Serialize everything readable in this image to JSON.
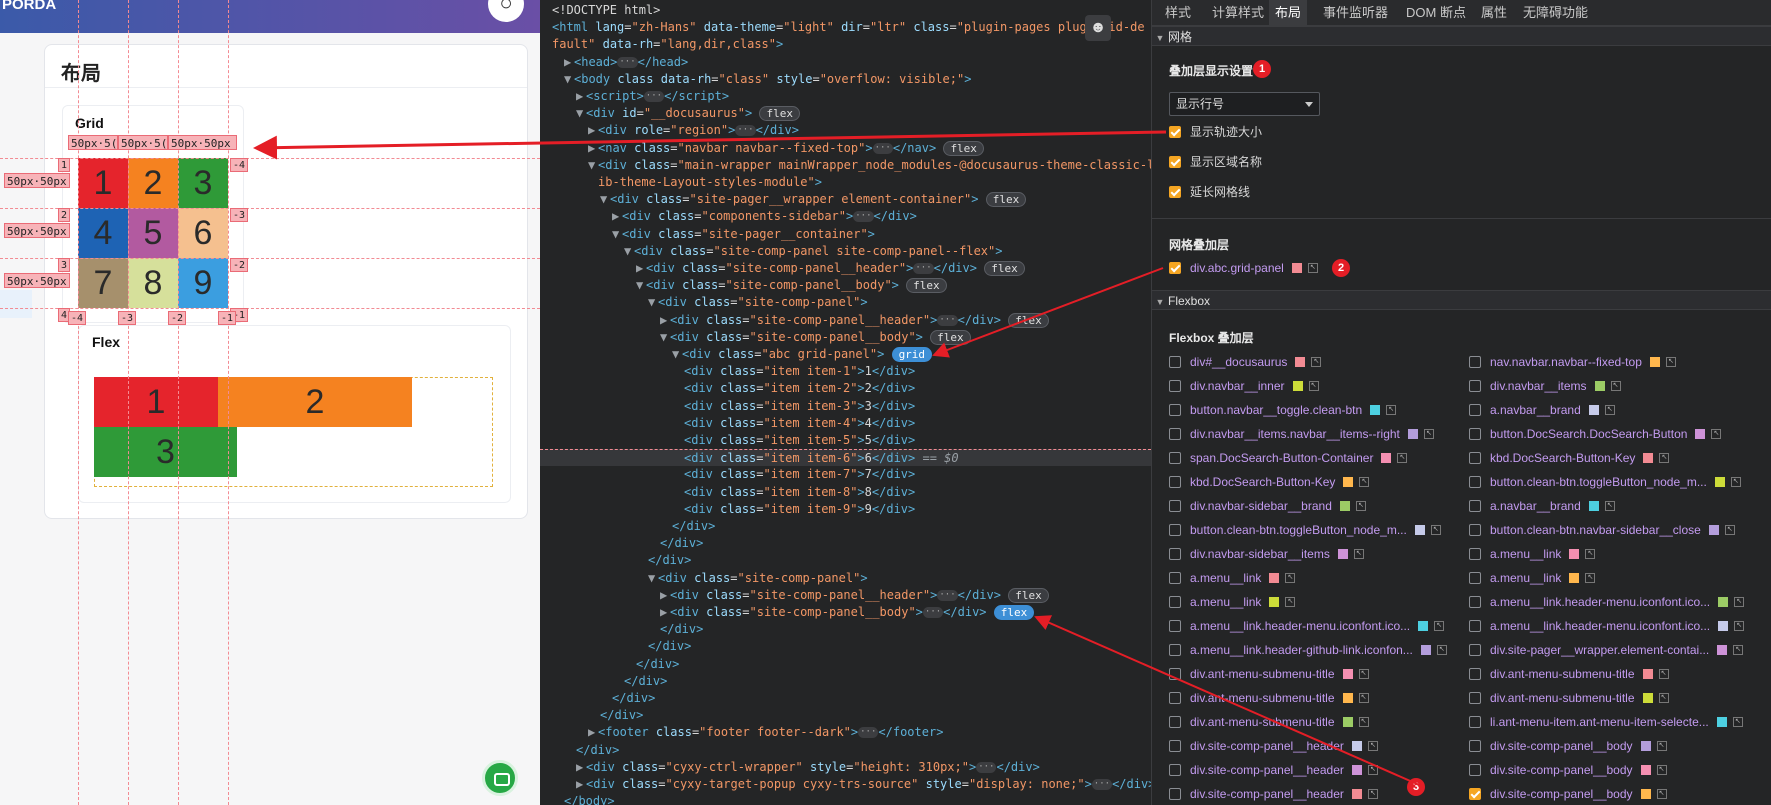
{
  "left_page": {
    "brand": "PORDA",
    "card_title": "布局",
    "grid_title": "Grid",
    "flex_title": "Flex",
    "col_size_labels": [
      "50px·5(",
      "50px·5(",
      "50px·50px"
    ],
    "row_size_labels": [
      "50px·50px",
      "50px·50px",
      "50px·50px"
    ],
    "row_line_left": [
      "1",
      "2",
      "3",
      "4"
    ],
    "row_line_right": [
      "-4",
      "-3",
      "-2",
      "-1"
    ],
    "col_line_bottom": [
      "-4",
      "-3",
      "-2",
      "-1"
    ],
    "grid_items": [
      {
        "label": "1",
        "color": "#e5242c"
      },
      {
        "label": "2",
        "color": "#f58220"
      },
      {
        "label": "3",
        "color": "#2f9a38"
      },
      {
        "label": "4",
        "color": "#1e63b4"
      },
      {
        "label": "5",
        "color": "#b25aa0"
      },
      {
        "label": "6",
        "color": "#f5c08f"
      },
      {
        "label": "7",
        "color": "#a6906c"
      },
      {
        "label": "8",
        "color": "#d6e09b"
      },
      {
        "label": "9",
        "color": "#3b9ee0"
      }
    ],
    "flex_items": [
      {
        "label": "1",
        "color": "#e5242c"
      },
      {
        "label": "2",
        "color": "#f58220"
      },
      {
        "label": "3",
        "color": "#2f9a38"
      }
    ]
  },
  "elements_panel": {
    "lines": [
      {
        "i": 0,
        "html": "&lt;!DOCTYPE html&gt;"
      },
      {
        "i": 0,
        "html": "<span class='t'>&lt;html</span> <span class='a'>lang</span>=<span class='v'>\"zh-Hans\"</span> <span class='a'>data-theme</span>=<span class='v'>\"light\"</span> <span class='a'>dir</span>=<span class='v'>\"ltr\"</span> <span class='a'>class</span>=<span class='v'>\"plugin-pages plugin-id-de</span>"
      },
      {
        "i": 0,
        "html": "<span class='v'>fault\"</span> <span class='a'>data-rh</span>=<span class='v'>\"lang,dir,class\"</span><span class='t'>&gt;</span>"
      },
      {
        "i": 1,
        "html": "<span class='ar'>▶</span><span class='t'>&lt;head&gt;</span><span class='dots'>···</span><span class='t'>&lt;/head&gt;</span>"
      },
      {
        "i": 1,
        "html": "<span class='ar'>▼</span><span class='t'>&lt;body</span> <span class='a'>class</span> <span class='a'>data-rh</span>=<span class='v'>\"class\"</span> <span class='a'>style</span>=<span class='v'>\"overflow: visible;\"</span><span class='t'>&gt;</span>"
      },
      {
        "i": 2,
        "html": "<span class='ar'>▶</span><span class='t'>&lt;script&gt;</span><span class='dots'>···</span><span class='t'>&lt;/script&gt;</span>"
      },
      {
        "i": 2,
        "html": "<span class='ar'>▼</span><span class='t'>&lt;div</span> <span class='a'>id</span>=<span class='v'>\"__docusaurus\"</span><span class='t'>&gt;</span> <span class='badge'>flex</span>"
      },
      {
        "i": 3,
        "html": "<span class='ar'>▶</span><span class='t'>&lt;div</span> <span class='a'>role</span>=<span class='v'>\"region\"</span><span class='t'>&gt;</span><span class='dots'>···</span><span class='t'>&lt;/div&gt;</span>"
      },
      {
        "i": 3,
        "html": "<span class='ar'>▶</span><span class='t'>&lt;nav</span> <span class='a'>class</span>=<span class='v'>\"navbar navbar--fixed-top\"</span><span class='t'>&gt;</span><span class='dots'>···</span><span class='t'>&lt;/nav&gt;</span> <span class='badge'>flex</span>"
      },
      {
        "i": 3,
        "html": "<span class='ar'>▼</span><span class='t'>&lt;div</span> <span class='a'>class</span>=<span class='v'>\"main-wrapper mainWrapper_node_modules-@docusaurus-theme-classic-l</span>"
      },
      {
        "i": 3,
        "html": "<span class='ar'> </span><span class='v'>ib-theme-Layout-styles-module\"</span><span class='t'>&gt;</span>"
      },
      {
        "i": 4,
        "html": "<span class='ar'>▼</span><span class='t'>&lt;div</span> <span class='a'>class</span>=<span class='v'>\"site-pager__wrapper element-container\"</span><span class='t'>&gt;</span> <span class='badge'>flex</span>"
      },
      {
        "i": 5,
        "html": "<span class='ar'>▶</span><span class='t'>&lt;div</span> <span class='a'>class</span>=<span class='v'>\"components-sidebar\"</span><span class='t'>&gt;</span><span class='dots'>···</span><span class='t'>&lt;/div&gt;</span>"
      },
      {
        "i": 5,
        "html": "<span class='ar'>▼</span><span class='t'>&lt;div</span> <span class='a'>class</span>=<span class='v'>\"site-pager__container\"</span><span class='t'>&gt;</span>"
      },
      {
        "i": 6,
        "html": "<span class='ar'>▼</span><span class='t'>&lt;div</span> <span class='a'>class</span>=<span class='v'>\"site-comp-panel site-comp-panel--flex\"</span><span class='t'>&gt;</span>"
      },
      {
        "i": 7,
        "html": "<span class='ar'>▶</span><span class='t'>&lt;div</span> <span class='a'>class</span>=<span class='v'>\"site-comp-panel__header\"</span><span class='t'>&gt;</span><span class='dots'>···</span><span class='t'>&lt;/div&gt;</span> <span class='badge'>flex</span>"
      },
      {
        "i": 7,
        "html": "<span class='ar'>▼</span><span class='t'>&lt;div</span> <span class='a'>class</span>=<span class='v'>\"site-comp-panel__body\"</span><span class='t'>&gt;</span> <span class='badge'>flex</span>"
      },
      {
        "i": 8,
        "html": "<span class='ar'>▼</span><span class='t'>&lt;div</span> <span class='a'>class</span>=<span class='v'>\"site-comp-panel\"</span><span class='t'>&gt;</span>"
      },
      {
        "i": 9,
        "html": "<span class='ar'>▶</span><span class='t'>&lt;div</span> <span class='a'>class</span>=<span class='v'>\"site-comp-panel__header\"</span><span class='t'>&gt;</span><span class='dots'>···</span><span class='t'>&lt;/div&gt;</span> <span class='badge'>flex</span>"
      },
      {
        "i": 9,
        "html": "<span class='ar'>▼</span><span class='t'>&lt;div</span> <span class='a'>class</span>=<span class='v'>\"site-comp-panel__body\"</span><span class='t'>&gt;</span> <span class='badge'>flex</span>"
      },
      {
        "i": 10,
        "html": "<span class='ar'>▼</span><span class='t'>&lt;div</span> <span class='a'>class</span>=<span class='v'>\"abc grid-panel\"</span><span class='t'>&gt;</span> <span class='badge sel'>grid</span>"
      },
      {
        "i": 11,
        "html": "<span class='t'>&lt;div</span> <span class='a'>class</span>=<span class='v'>\"item item-1\"</span><span class='t'>&gt;</span><span class='p'>1</span><span class='t'>&lt;/div&gt;</span>"
      },
      {
        "i": 11,
        "html": "<span class='t'>&lt;div</span> <span class='a'>class</span>=<span class='v'>\"item item-2\"</span><span class='t'>&gt;</span><span class='p'>2</span><span class='t'>&lt;/div&gt;</span>"
      },
      {
        "i": 11,
        "html": "<span class='t'>&lt;div</span> <span class='a'>class</span>=<span class='v'>\"item item-3\"</span><span class='t'>&gt;</span><span class='p'>3</span><span class='t'>&lt;/div&gt;</span>"
      },
      {
        "i": 11,
        "html": "<span class='t'>&lt;div</span> <span class='a'>class</span>=<span class='v'>\"item item-4\"</span><span class='t'>&gt;</span><span class='p'>4</span><span class='t'>&lt;/div&gt;</span>"
      },
      {
        "i": 11,
        "html": "<span class='t'>&lt;div</span> <span class='a'>class</span>=<span class='v'>\"item item-5\"</span><span class='t'>&gt;</span><span class='p'>5</span><span class='t'>&lt;/div&gt;</span>"
      },
      {
        "i": 11,
        "hl": true,
        "html": "<span class='t'>&lt;div</span> <span class='a'>class</span>=<span class='v'>\"item item-6\"</span><span class='t'>&gt;</span><span class='p'>6</span><span class='t'>&lt;/div&gt;</span> <span class='dim'>== $0</span>"
      },
      {
        "i": 11,
        "html": "<span class='t'>&lt;div</span> <span class='a'>class</span>=<span class='v'>\"item item-7\"</span><span class='t'>&gt;</span><span class='p'>7</span><span class='t'>&lt;/div&gt;</span>"
      },
      {
        "i": 11,
        "html": "<span class='t'>&lt;div</span> <span class='a'>class</span>=<span class='v'>\"item item-8\"</span><span class='t'>&gt;</span><span class='p'>8</span><span class='t'>&lt;/div&gt;</span>"
      },
      {
        "i": 11,
        "html": "<span class='t'>&lt;div</span> <span class='a'>class</span>=<span class='v'>\"item item-9\"</span><span class='t'>&gt;</span><span class='p'>9</span><span class='t'>&lt;/div&gt;</span>"
      },
      {
        "i": 10,
        "html": "<span class='t'>&lt;/div&gt;</span>"
      },
      {
        "i": 9,
        "html": "<span class='t'>&lt;/div&gt;</span>"
      },
      {
        "i": 8,
        "html": "<span class='t'>&lt;/div&gt;</span>"
      },
      {
        "i": 8,
        "html": "<span class='ar'>▼</span><span class='t'>&lt;div</span> <span class='a'>class</span>=<span class='v'>\"site-comp-panel\"</span><span class='t'>&gt;</span>"
      },
      {
        "i": 9,
        "html": "<span class='ar'>▶</span><span class='t'>&lt;div</span> <span class='a'>class</span>=<span class='v'>\"site-comp-panel__header\"</span><span class='t'>&gt;</span><span class='dots'>···</span><span class='t'>&lt;/div&gt;</span> <span class='badge'>flex</span>"
      },
      {
        "i": 9,
        "html": "<span class='ar'>▶</span><span class='t'>&lt;div</span> <span class='a'>class</span>=<span class='v'>\"site-comp-panel__body\"</span><span class='t'>&gt;</span><span class='dots'>···</span><span class='t'>&lt;/div&gt;</span> <span class='badge sel'>flex</span>"
      },
      {
        "i": 9,
        "html": "<span class='t'>&lt;/div&gt;</span>"
      },
      {
        "i": 8,
        "html": "<span class='t'>&lt;/div&gt;</span>"
      },
      {
        "i": 7,
        "html": "<span class='t'>&lt;/div&gt;</span>"
      },
      {
        "i": 6,
        "html": "<span class='t'>&lt;/div&gt;</span>"
      },
      {
        "i": 5,
        "html": "<span class='t'>&lt;/div&gt;</span>"
      },
      {
        "i": 4,
        "html": "<span class='t'>&lt;/div&gt;</span>"
      },
      {
        "i": 3,
        "html": "<span class='ar'>▶</span><span class='t'>&lt;footer</span> <span class='a'>class</span>=<span class='v'>\"footer footer--dark\"</span><span class='t'>&gt;</span><span class='dots'>···</span><span class='t'>&lt;/footer&gt;</span>"
      },
      {
        "i": 2,
        "html": "<span class='t'>&lt;/div&gt;</span>"
      },
      {
        "i": 2,
        "html": "<span class='ar'>▶</span><span class='t'>&lt;div</span> <span class='a'>class</span>=<span class='v'>\"cyxy-ctrl-wrapper\"</span> <span class='a'>style</span>=<span class='v'>\"height: 310px;\"</span><span class='t'>&gt;</span><span class='dots'>···</span><span class='t'>&lt;/div&gt;</span>"
      },
      {
        "i": 2,
        "html": "<span class='ar'>▶</span><span class='t'>&lt;div</span> <span class='a'>class</span>=<span class='v'>\"cyxy-target-popup cyxy-trs-source\"</span> <span class='a'>style</span>=<span class='v'>\"display: none;\"</span><span class='t'>&gt;</span><span class='dots'>···</span><span class='t'>&lt;/div&gt;</span>"
      },
      {
        "i": 1,
        "html": "<span class='t'>&lt;/body&gt;</span>"
      }
    ],
    "gutter_marker": "···"
  },
  "right_panel": {
    "tabs": [
      "样式",
      "计算样式",
      "布局",
      "事件监听器",
      "DOM 断点",
      "属性",
      "无障碍功能"
    ],
    "active_tab": 2,
    "grid_section": "网格",
    "overlay_settings_title": "叠加层显示设置",
    "line_select_value": "显示行号",
    "options": [
      {
        "label": "显示轨迹大小",
        "checked": true
      },
      {
        "label": "显示区域名称",
        "checked": true
      },
      {
        "label": "延长网格线",
        "checked": true
      }
    ],
    "grid_overlays_title": "网格叠加层",
    "grid_overlay_item": {
      "label": "div.abc.grid-panel",
      "color": "#f28b93",
      "checked": true
    },
    "flexbox_section": "Flexbox",
    "flexbox_overlays_title": "Flexbox 叠加层",
    "flex_left": [
      {
        "label": "div#__docusaurus",
        "color": "#f28b93",
        "checked": false
      },
      {
        "label": "div.navbar__inner",
        "color": "#cddc39",
        "checked": false
      },
      {
        "label": "button.navbar__toggle.clean-btn",
        "color": "#4dd0e1",
        "checked": false
      },
      {
        "label": "div.navbar__items.navbar__items--right",
        "color": "#b39ddb",
        "checked": false
      },
      {
        "label": "span.DocSearch-Button-Container",
        "color": "#f48fb1",
        "checked": false
      },
      {
        "label": "kbd.DocSearch-Button-Key",
        "color": "#ffb74d",
        "checked": false
      },
      {
        "label": "div.navbar-sidebar__brand",
        "color": "#9ccc65",
        "checked": false
      },
      {
        "label": "button.clean-btn.toggleButton_node_m...",
        "color": "#c5cae9",
        "checked": false
      },
      {
        "label": "div.navbar-sidebar__items",
        "color": "#ce93d8",
        "checked": false
      },
      {
        "label": "a.menu__link",
        "color": "#f28b93",
        "checked": false
      },
      {
        "label": "a.menu__link",
        "color": "#cddc39",
        "checked": false
      },
      {
        "label": "a.menu__link.header-menu.iconfont.ico...",
        "color": "#4dd0e1",
        "checked": false
      },
      {
        "label": "a.menu__link.header-github-link.iconfon...",
        "color": "#b39ddb",
        "checked": false
      },
      {
        "label": "div.ant-menu-submenu-title",
        "color": "#f48fb1",
        "checked": false
      },
      {
        "label": "div.ant-menu-submenu-title",
        "color": "#ffb74d",
        "checked": false
      },
      {
        "label": "div.ant-menu-submenu-title",
        "color": "#9ccc65",
        "checked": false
      },
      {
        "label": "div.site-comp-panel__header",
        "color": "#c5cae9",
        "checked": false
      },
      {
        "label": "div.site-comp-panel__header",
        "color": "#ce93d8",
        "checked": false
      },
      {
        "label": "div.site-comp-panel__header",
        "color": "#f28b93",
        "checked": false
      }
    ],
    "flex_right": [
      {
        "label": "nav.navbar.navbar--fixed-top",
        "color": "#ffb74d",
        "checked": false
      },
      {
        "label": "div.navbar__items",
        "color": "#9ccc65",
        "checked": false
      },
      {
        "label": "a.navbar__brand",
        "color": "#c5cae9",
        "checked": false
      },
      {
        "label": "button.DocSearch.DocSearch-Button",
        "color": "#ce93d8",
        "checked": false
      },
      {
        "label": "kbd.DocSearch-Button-Key",
        "color": "#f28b93",
        "checked": false
      },
      {
        "label": "button.clean-btn.toggleButton_node_m...",
        "color": "#cddc39",
        "checked": false
      },
      {
        "label": "a.navbar__brand",
        "color": "#4dd0e1",
        "checked": false
      },
      {
        "label": "button.clean-btn.navbar-sidebar__close",
        "color": "#b39ddb",
        "checked": false
      },
      {
        "label": "a.menu__link",
        "color": "#f48fb1",
        "checked": false
      },
      {
        "label": "a.menu__link",
        "color": "#ffb74d",
        "checked": false
      },
      {
        "label": "a.menu__link.header-menu.iconfont.ico...",
        "color": "#9ccc65",
        "checked": false
      },
      {
        "label": "a.menu__link.header-menu.iconfont.ico...",
        "color": "#c5cae9",
        "checked": false
      },
      {
        "label": "div.site-pager__wrapper.element-contai...",
        "color": "#ce93d8",
        "checked": false
      },
      {
        "label": "div.ant-menu-submenu-title",
        "color": "#f28b93",
        "checked": false
      },
      {
        "label": "div.ant-menu-submenu-title",
        "color": "#cddc39",
        "checked": false
      },
      {
        "label": "li.ant-menu-item.ant-menu-item-selecte...",
        "color": "#4dd0e1",
        "checked": false
      },
      {
        "label": "div.site-comp-panel__body",
        "color": "#b39ddb",
        "checked": false
      },
      {
        "label": "div.site-comp-panel__body",
        "color": "#f48fb1",
        "checked": false
      },
      {
        "label": "div.site-comp-panel__body",
        "color": "#ffb74d",
        "checked": true
      }
    ],
    "markers": [
      "1",
      "2",
      "3"
    ]
  }
}
